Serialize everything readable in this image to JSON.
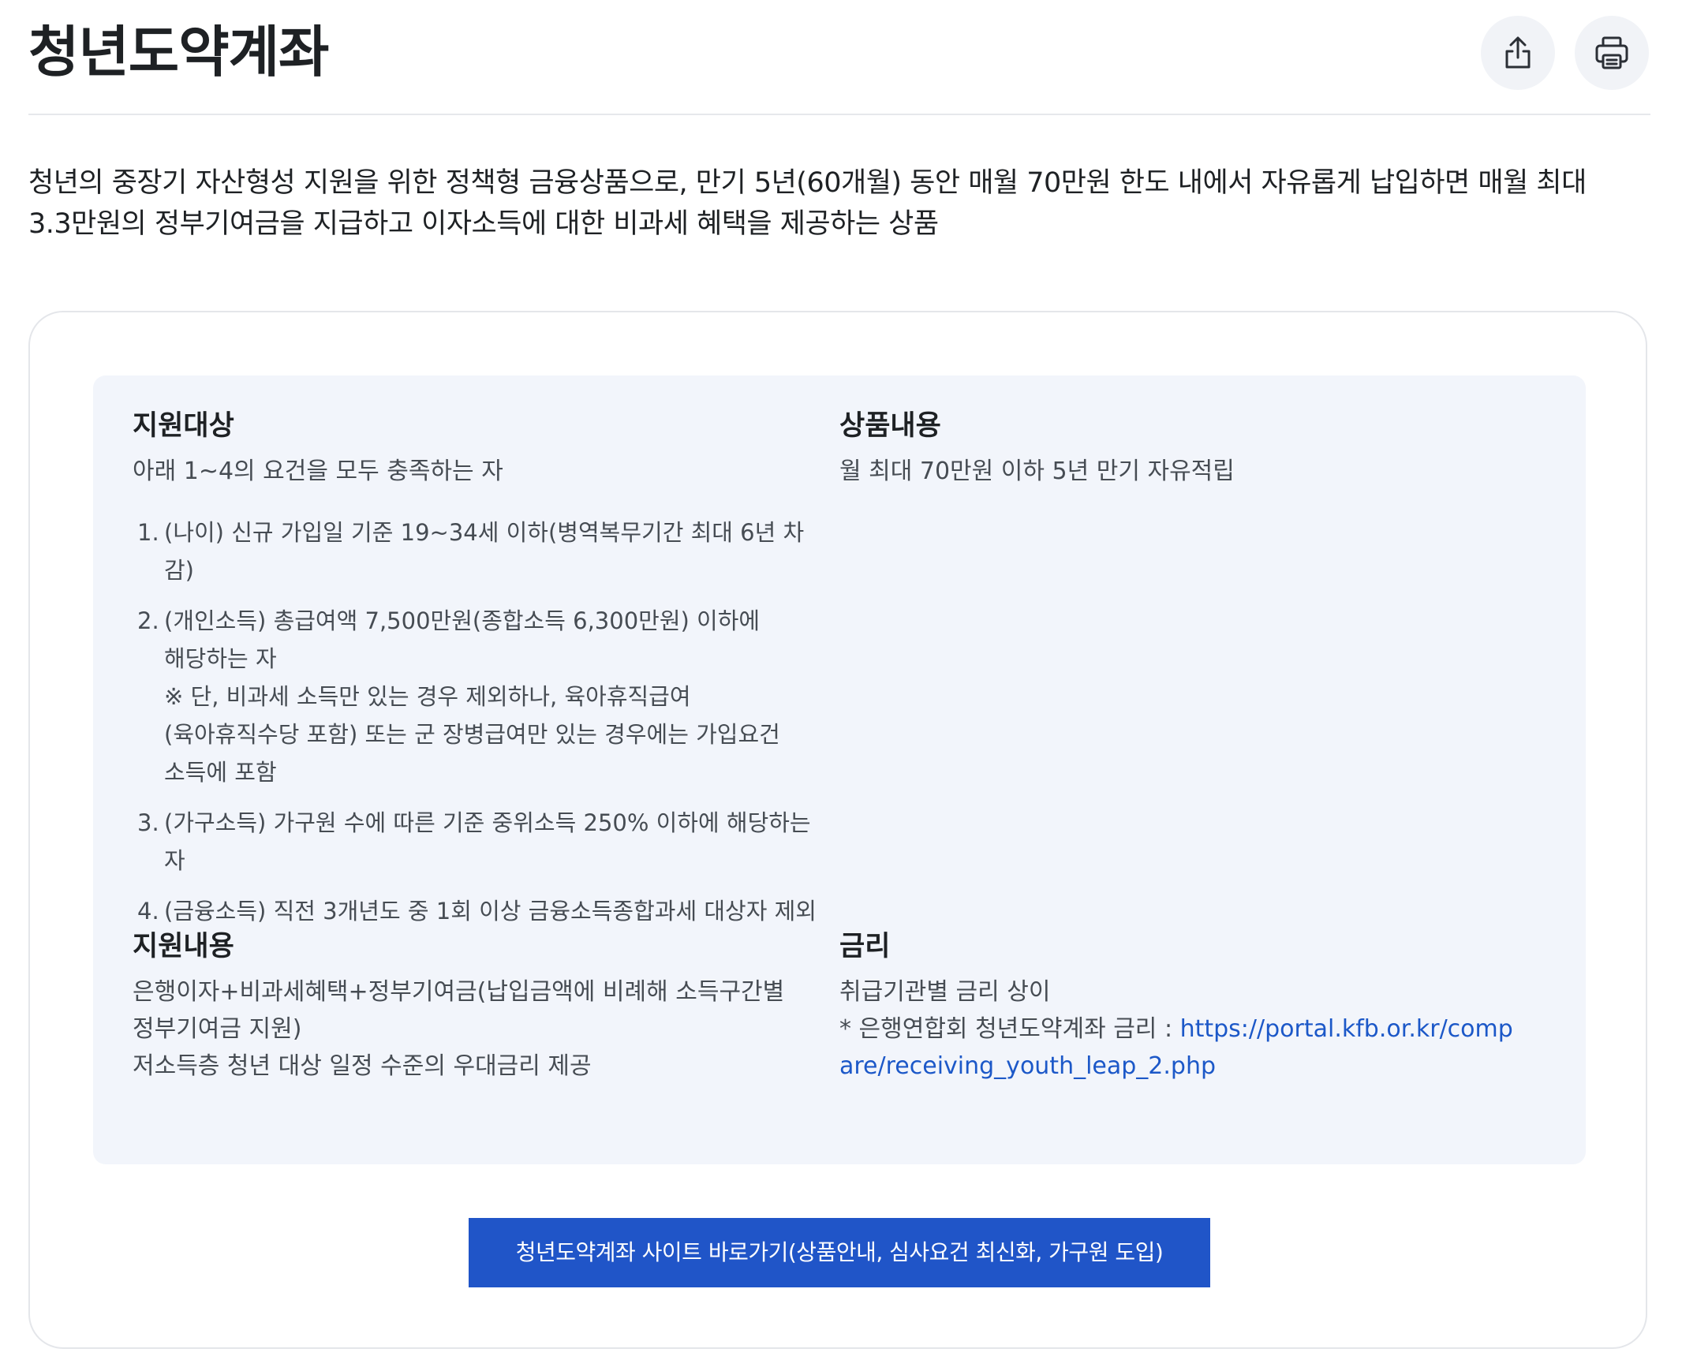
{
  "header": {
    "title": "청년도약계좌",
    "share_icon": "share-icon",
    "print_icon": "print-icon"
  },
  "summary": {
    "line1": "청년의 중장기 자산형성 지원을 위한 정책형 금융상품으로, 만기 5년(60개월) 동안 매월 70만원 한도 내에서 자유롭게 납입하면 매월 최대",
    "line2": "3.3만원의 정부기여금을 지급하고 이자소득에 대한 비과세 혜택을 제공하는 상품"
  },
  "sections": {
    "target": {
      "title": "지원대상",
      "intro": "아래 1~4의 요건을 모두 충족하는 자",
      "items": [
        {
          "num": "1.",
          "lines": [
            "(나이) 신규 가입일 기준 19~34세 이하(병역복무기간 최대 6년 차감)"
          ]
        },
        {
          "num": "2.",
          "lines": [
            "(개인소득) 총급여액 7,500만원(종합소득 6,300만원) 이하에",
            "해당하는 자",
            "※ 단, 비과세 소득만 있는 경우 제외하나, 육아휴직급여",
            "(육아휴직수당 포함) 또는 군 장병급여만 있는 경우에는 가입요건",
            "소득에 포함"
          ]
        },
        {
          "num": "3.",
          "lines": [
            "(가구소득) 가구원 수에 따른 기준 중위소득 250% 이하에 해당하는",
            "자"
          ]
        },
        {
          "num": "4.",
          "lines": [
            "(금융소득) 직전 3개년도 중 1회 이상 금융소득종합과세 대상자 제외"
          ]
        }
      ]
    },
    "product": {
      "title": "상품내용",
      "text": "월 최대 70만원 이하 5년 만기 자유적립"
    },
    "support": {
      "title": "지원내용",
      "line1": "은행이자+비과세혜택+정부기여금(납입금액에 비례해 소득구간별",
      "line2": "정부기여금 지원)",
      "line3": "저소득층 청년 대상 일정 수준의 우대금리 제공"
    },
    "rate": {
      "title": "금리",
      "line1": "취급기관별 금리 상이",
      "note_prefix": "* 은행연합회 청년도약계좌 금리 : ",
      "link_part1": "https://portal.kfb.or.kr/comp",
      "link_part2": "are/receiving_youth_leap_2.php"
    }
  },
  "cta": {
    "label": "청년도약계좌 사이트 바로가기(상품안내, 심사요건 최신화, 가구원 도입)",
    "color": "#2055c8"
  }
}
